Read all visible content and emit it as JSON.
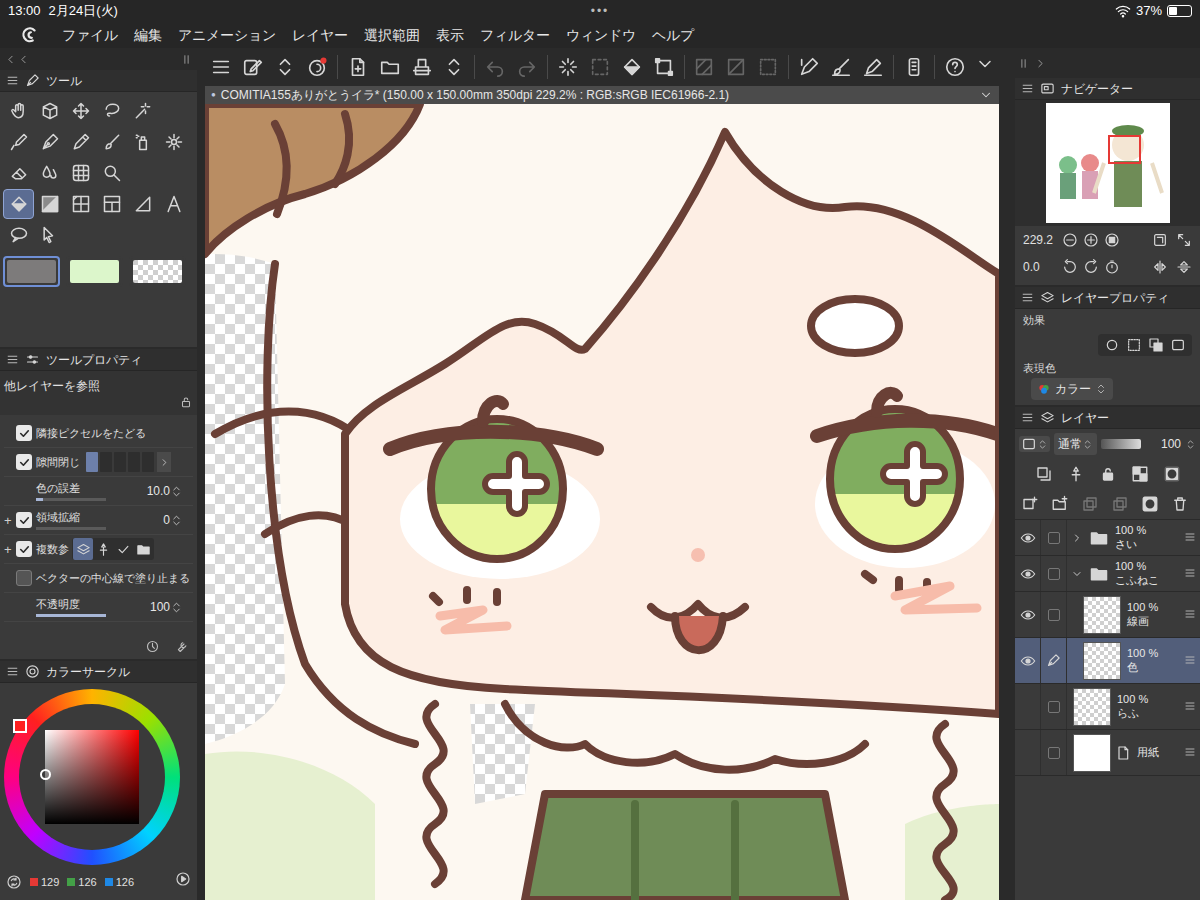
{
  "status_bar": {
    "time": "13:00",
    "date": "2月24日(火)",
    "dots": "•••",
    "battery": "37%",
    "level": 0.37
  },
  "menu": [
    "ファイル",
    "編集",
    "アニメーション",
    "レイヤー",
    "選択範囲",
    "表示",
    "フィルター",
    "ウィンドウ",
    "ヘルプ"
  ],
  "command_bar": [
    {
      "disabled": false
    },
    {
      "disabled": false
    },
    {
      "disabled": false
    },
    {
      "disabled": false
    },
    {
      "disabled": false
    },
    {
      "disabled": false
    },
    {
      "disabled": false
    },
    {
      "disabled": false
    },
    {
      "disabled": true
    },
    {
      "disabled": true
    },
    {
      "disabled": false
    },
    {
      "disabled": true
    },
    {
      "disabled": false
    },
    {
      "disabled": false
    },
    {
      "disabled": true
    },
    {
      "disabled": true
    },
    {
      "disabled": true
    },
    {
      "disabled": false
    },
    {
      "disabled": false
    },
    {
      "disabled": false
    },
    {
      "disabled": false
    },
    {
      "disabled": false
    }
  ],
  "document": {
    "dot": "●",
    "title": "COMITIA155ありがとうイラ* (150.00 x 150.00mm 350dpi 229.2% : RGB:sRGB IEC61966-2.1)"
  },
  "tool_panel": {
    "title": "ツール",
    "tools": [
      {
        "selected": false
      },
      {
        "selected": false
      },
      {
        "selected": false
      },
      {
        "selected": false
      },
      {
        "selected": false
      },
      {
        "selected": false
      },
      {
        "selected": false
      },
      {
        "selected": false
      },
      {
        "selected": false
      },
      {
        "selected": false
      },
      {
        "selected": false
      },
      {
        "selected": false
      },
      {
        "selected": false
      },
      {
        "selected": false
      },
      {
        "selected": false
      },
      {
        "selected": true
      },
      {
        "selected": false
      },
      {
        "selected": false
      },
      {
        "selected": false
      },
      {
        "selected": false
      },
      {
        "selected": false
      },
      {
        "selected": false
      },
      {
        "selected": false
      }
    ],
    "colors": [
      {
        "kind": "color",
        "color": "#7d7b7b",
        "selected": true
      },
      {
        "kind": "color",
        "color": "#dcf6cb",
        "selected": false
      },
      {
        "kind": "transparent",
        "selected": false
      }
    ]
  },
  "tool_property": {
    "title": "ツールプロパティ",
    "reference": "他レイヤーを参照",
    "rows": [
      {
        "kind": "check",
        "label": "隣接ピクセルをたどる",
        "checked": true
      },
      {
        "kind": "gap",
        "label": "隙間閉じ",
        "checked": true,
        "level": 0.2
      },
      {
        "kind": "slider",
        "label": "色の誤差",
        "value": "10.0",
        "level": 0.1
      },
      {
        "kind": "check-slider",
        "label": "領域拡縮",
        "plus": "+",
        "checked": true,
        "value": "0",
        "level": 0
      },
      {
        "kind": "multi",
        "label": "複数参",
        "plus": "+",
        "checked": true,
        "options": [
          {
            "selected": true
          },
          {
            "selected": false
          },
          {
            "selected": false
          },
          {
            "selected": false
          }
        ]
      },
      {
        "kind": "check",
        "label": "ベクターの中心線で塗り止まる",
        "checked": false
      },
      {
        "kind": "slider",
        "label": "不透明度",
        "value": "100",
        "level": 1
      }
    ]
  },
  "color_circle": {
    "title": "カラーサークル",
    "r": "129",
    "g": "126",
    "b": "126"
  },
  "navigator": {
    "title": "ナビゲーター",
    "zoom": "229.2",
    "angle": "0.0"
  },
  "layer_property": {
    "title": "レイヤープロパティ",
    "effect_label": "効果",
    "color_label": "表現色",
    "color_mode": "カラー"
  },
  "layers": {
    "title": "レイヤー",
    "blend": "通常",
    "opacity": "100",
    "items": [
      {
        "name": "さい",
        "opacity": "100 %",
        "kind": "folder",
        "visible": true,
        "expanded": false,
        "child": false,
        "selected": false,
        "editing": false
      },
      {
        "name": "こふねこ",
        "opacity": "100 %",
        "kind": "folder",
        "visible": true,
        "expanded": true,
        "child": false,
        "selected": false,
        "editing": false
      },
      {
        "name": "線画",
        "opacity": "100 %",
        "kind": "raster",
        "visible": true,
        "child": true,
        "selected": false,
        "editing": false
      },
      {
        "name": "色",
        "opacity": "100 %",
        "kind": "raster",
        "visible": true,
        "child": true,
        "selected": true,
        "editing": true
      },
      {
        "name": "らふ",
        "opacity": "100 %",
        "kind": "raster",
        "visible": false,
        "child": false,
        "selected": false,
        "editing": false
      },
      {
        "name": "用紙",
        "kind": "paper",
        "visible": false,
        "child": false,
        "selected": false,
        "editing": false
      }
    ]
  }
}
